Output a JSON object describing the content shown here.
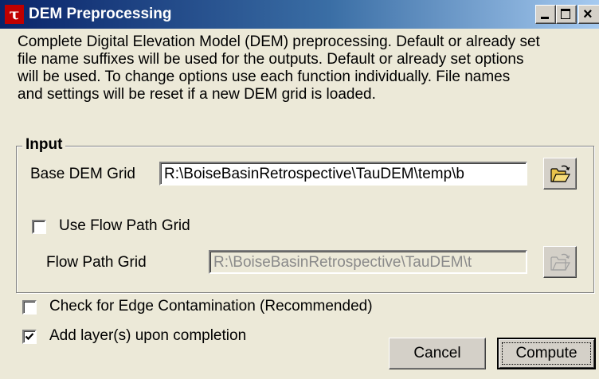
{
  "window": {
    "title": "DEM Preprocessing",
    "icon_letter": "τ"
  },
  "description": "Complete Digital Elevation Model (DEM) preprocessing.  Default or already set\nfile name suffixes will be used for the outputs.  Default or already set options\nwill be used.  To change options use each function individually.  File names\nand settings will be reset if a new DEM grid is loaded.",
  "input_group": {
    "label": "Input",
    "base_dem": {
      "label": "Base DEM Grid",
      "value": "R:\\BoiseBasinRetrospective\\TauDEM\\temp\\b"
    },
    "use_flow_path": {
      "label": "Use Flow Path Grid",
      "checked": false
    },
    "flow_path": {
      "label": "Flow Path Grid",
      "value": "R:\\BoiseBasinRetrospective\\TauDEM\\t",
      "enabled": false
    }
  },
  "options": {
    "edge_contamination": {
      "label": "Check for Edge Contamination (Recommended)",
      "checked": false
    },
    "add_layers": {
      "label": "Add layer(s) upon completion",
      "checked": true
    }
  },
  "buttons": {
    "cancel": "Cancel",
    "compute": "Compute"
  },
  "icons": {
    "browse": "folder-open-icon",
    "minimize": "minimize-icon",
    "maximize": "maximize-icon",
    "close": "close-icon"
  }
}
